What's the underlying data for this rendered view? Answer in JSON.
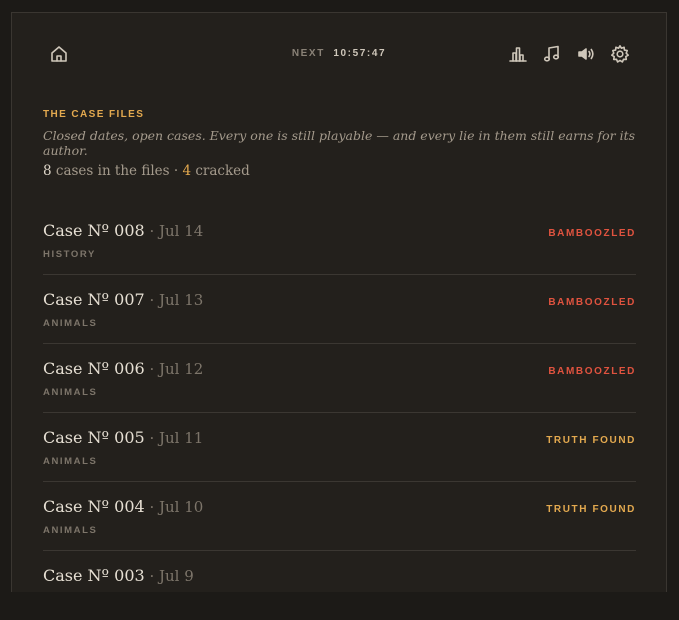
{
  "header": {
    "next_label": "NEXT",
    "next_time": "10:57:47",
    "icons": [
      "home-icon",
      "stats-icon",
      "music-icon",
      "sound-icon",
      "gear-icon"
    ]
  },
  "section": {
    "title": "THE CASE FILES",
    "subtitle": "Closed dates, open cases. Every one is still playable — and every lie in them still earns for its author.",
    "cases_count": "8",
    "cases_text": " cases in the files · ",
    "cracked_count": "4",
    "cracked_text": " cracked"
  },
  "cases": [
    {
      "title": "Case Nº 008",
      "date": " · Jul 14",
      "category": "HISTORY",
      "verdict": "BAMBOOZLED"
    },
    {
      "title": "Case Nº 007",
      "date": " · Jul 13",
      "category": "ANIMALS",
      "verdict": "BAMBOOZLED"
    },
    {
      "title": "Case Nº 006",
      "date": " · Jul 12",
      "category": "ANIMALS",
      "verdict": "BAMBOOZLED"
    },
    {
      "title": "Case Nº 005",
      "date": " · Jul 11",
      "category": "ANIMALS",
      "verdict": "TRUTH FOUND"
    },
    {
      "title": "Case Nº 004",
      "date": " · Jul 10",
      "category": "ANIMALS",
      "verdict": "TRUTH FOUND"
    },
    {
      "title": "Case Nº 003",
      "date": " · Jul 9",
      "category": "",
      "verdict": ""
    }
  ],
  "colors": {
    "accent": "#e3a94f",
    "bamboozled": "#e0533f",
    "background": "#23201c"
  }
}
